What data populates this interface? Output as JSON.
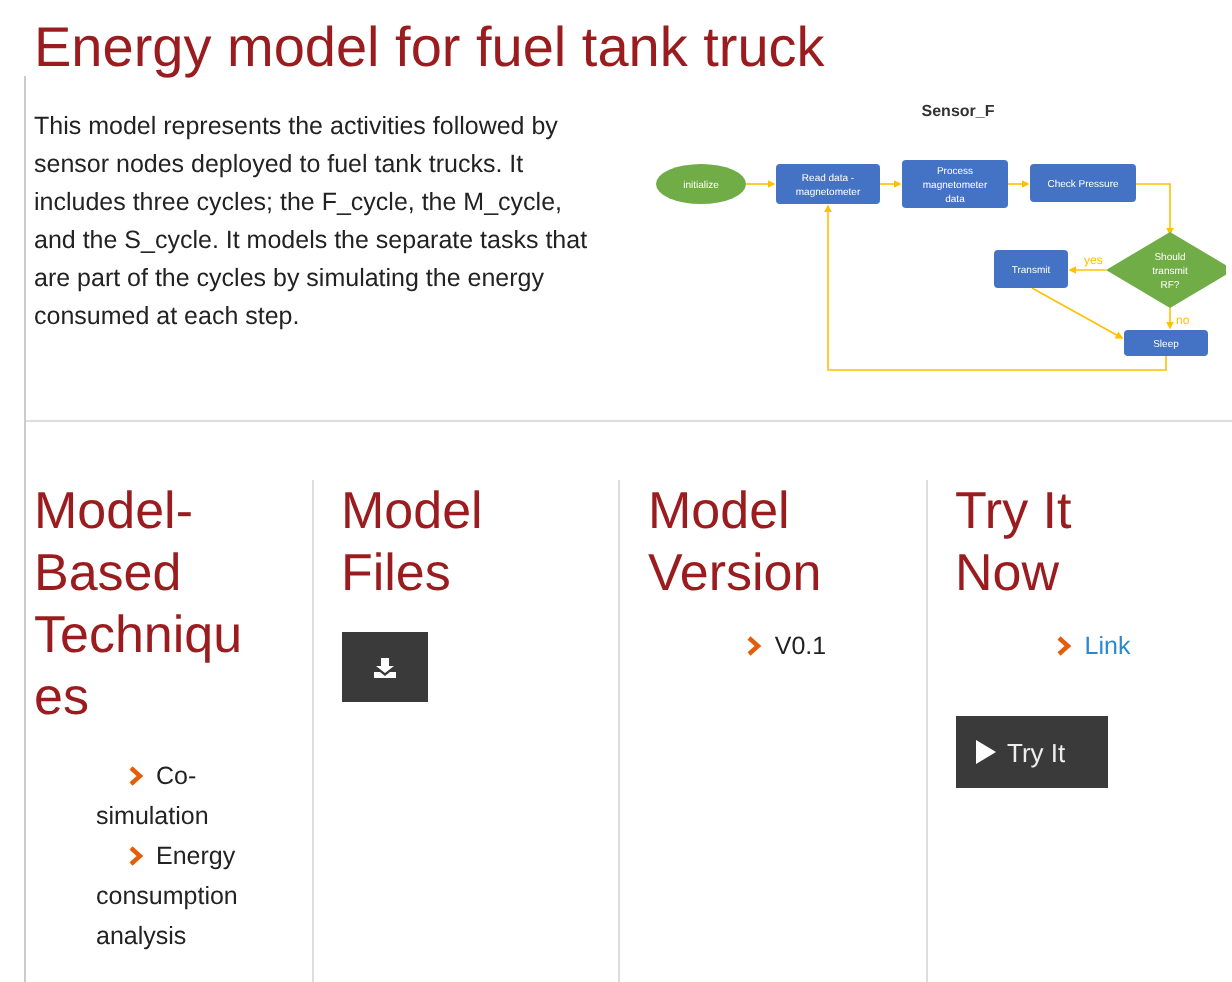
{
  "title": "Energy model for fuel tank truck",
  "description": "This model represents the activities followed by sensor nodes deployed to fuel tank trucks. It includes three cycles; the F_cycle, the M_cycle, and the S_cycle. It models the separate tasks that are part of the cycles by simulating the energy consumed at each step.",
  "diagram": {
    "title": "Sensor_F",
    "nodes": [
      {
        "kind": "ellipse",
        "lines": [
          "initialize"
        ]
      },
      {
        "kind": "rect",
        "lines": [
          "Read data -",
          "magnetometer"
        ]
      },
      {
        "kind": "rect",
        "lines": [
          "Process",
          "magnetometer",
          "data"
        ]
      },
      {
        "kind": "rect",
        "lines": [
          "Check Pressure"
        ]
      },
      {
        "kind": "rect",
        "lines": [
          "Transmit"
        ]
      },
      {
        "kind": "diamond",
        "lines": [
          "Should",
          "transmit",
          "RF?"
        ]
      },
      {
        "kind": "rect",
        "lines": [
          "Sleep"
        ]
      }
    ],
    "edge_labels": [
      "yes",
      "no"
    ]
  },
  "columns": [
    {
      "heading": [
        "Model-",
        "Based",
        "Techniqu",
        "es"
      ],
      "kind": "list",
      "items": [
        "Co-simulation",
        "Energy consumption analysis"
      ]
    },
    {
      "heading": [
        "Model",
        "Files"
      ],
      "kind": "download"
    },
    {
      "heading": [
        "Model",
        "Version"
      ],
      "kind": "list-center",
      "items": [
        "V0.1"
      ]
    },
    {
      "heading": [
        "Try It",
        "Now"
      ],
      "kind": "try",
      "link": "Link",
      "button": "Try It"
    }
  ]
}
